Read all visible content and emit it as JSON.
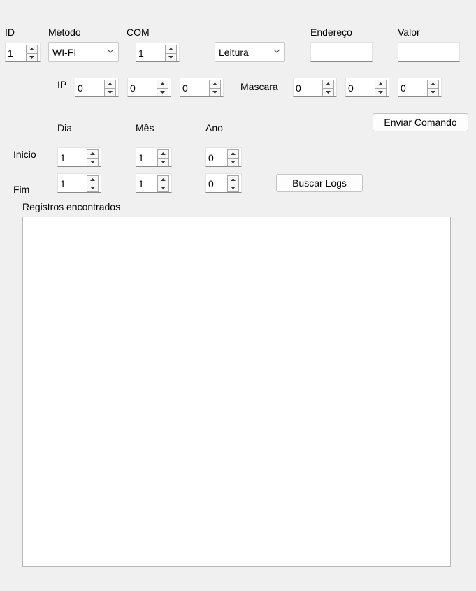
{
  "labels": {
    "id": "ID",
    "metodo": "Método",
    "com": "COM",
    "endereco": "Endereço",
    "valor": "Valor",
    "ip": "IP",
    "mascara": "Mascara",
    "dia": "Dia",
    "mes": "Mês",
    "ano": "Ano",
    "inicio": "Inicio",
    "fim": "Fim",
    "registros": "Registros encontrados"
  },
  "fields": {
    "id": "1",
    "metodo": "WI-FI",
    "com": "1",
    "operacao": "Leitura",
    "endereco": "",
    "valor": "",
    "ip": [
      "0",
      "0",
      "0"
    ],
    "mascara": [
      "0",
      "0",
      "0"
    ],
    "inicio": {
      "dia": "1",
      "mes": "1",
      "ano": "0"
    },
    "fim": {
      "dia": "1",
      "mes": "1",
      "ano": "0"
    }
  },
  "buttons": {
    "enviar": "Enviar Comando",
    "buscar": "Buscar Logs"
  },
  "icons": {
    "spin_up": "arrow-up-icon",
    "spin_down": "arrow-down-icon",
    "combo": "chevron-down-icon"
  }
}
